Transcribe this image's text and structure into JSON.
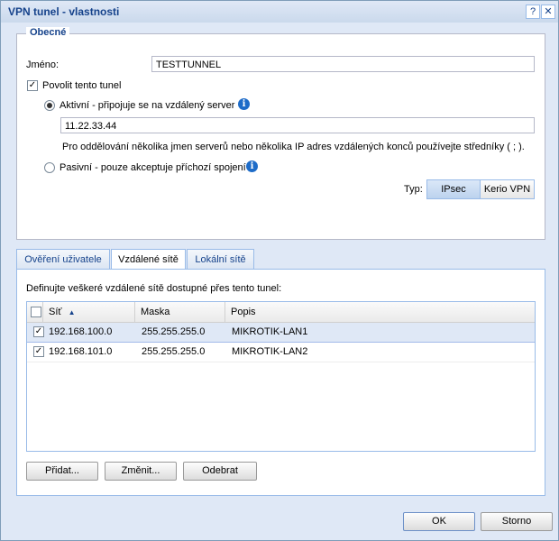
{
  "window": {
    "title": "VPN tunel - vlastnosti"
  },
  "general": {
    "legend": "Obecné",
    "name_label": "Jméno:",
    "name_value": "TESTTUNNEL",
    "enable_label": "Povolit tento tunel",
    "active_label": "Aktivní - připojuje se na vzdálený server",
    "server_value": "11.22.33.44",
    "hint": "Pro oddělování několika jmen serverů nebo několika IP adres vzdálených konců používejte středníky ( ; ).",
    "passive_label": "Pasivní - pouze akceptuje příchozí spojení",
    "type_label": "Typ:",
    "type_options": [
      "IPsec",
      "Kerio VPN"
    ],
    "info_glyph": "i"
  },
  "tabs": [
    "Ověření uživatele",
    "Vzdálené sítě",
    "Lokální sítě"
  ],
  "remote": {
    "description": "Definujte veškeré vzdálené sítě dostupné přes tento tunel:",
    "columns": [
      "Síť",
      "Maska",
      "Popis"
    ],
    "sort_glyph": "▲",
    "rows": [
      {
        "net": "192.168.100.0",
        "mask": "255.255.255.0",
        "desc": "MIKROTIK-LAN1"
      },
      {
        "net": "192.168.101.0",
        "mask": "255.255.255.0",
        "desc": "MIKROTIK-LAN2"
      }
    ],
    "buttons": {
      "add": "Přidat...",
      "edit": "Změnit...",
      "remove": "Odebrat"
    }
  },
  "footer": {
    "ok": "OK",
    "cancel": "Storno"
  },
  "titlebar_buttons": {
    "help": "?",
    "close": "✕"
  },
  "check_glyph": "✓"
}
